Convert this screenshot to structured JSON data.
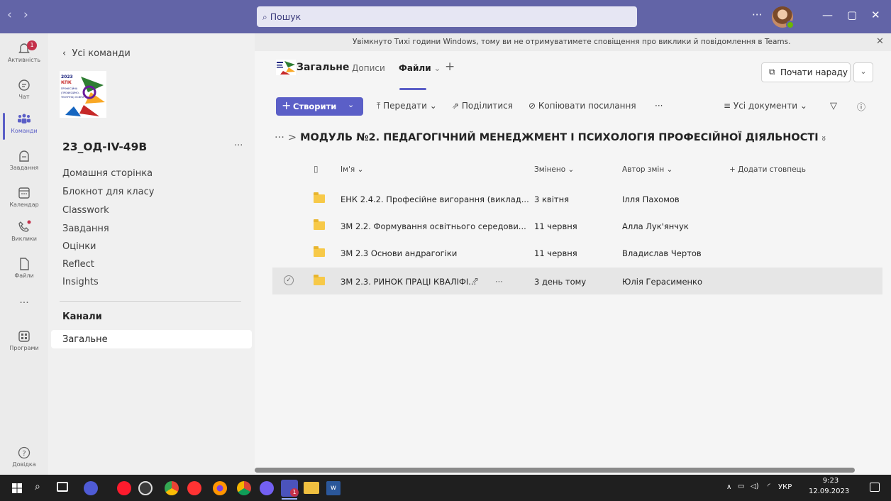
{
  "titlebar": {
    "back": "‹",
    "forward": "›",
    "search_placeholder": "Пошук",
    "more": "···",
    "minimize": "—",
    "maximize": "▢",
    "close": "✕"
  },
  "rail": {
    "items": [
      {
        "label": "Активність",
        "icon": "bell-icon",
        "badge": "1"
      },
      {
        "label": "Чат",
        "icon": "chat-icon"
      },
      {
        "label": "Команди",
        "icon": "teams-icon",
        "active": true
      },
      {
        "label": "Завдання",
        "icon": "assignments-icon"
      },
      {
        "label": "Календар",
        "icon": "calendar-icon"
      },
      {
        "label": "Виклики",
        "icon": "phone-icon"
      },
      {
        "label": "Файли",
        "icon": "file-icon"
      },
      {
        "label": "···",
        "icon": "more-icon"
      },
      {
        "label": "Програми",
        "icon": "apps-icon"
      }
    ],
    "help_label": "Довідка"
  },
  "teampane": {
    "back_label": "Усі команди",
    "logo_text": "2023 КПК ПРОФЕСІЙНА (ПРОФЕСІЙНО-ТЕХНІЧНА) ОСВІТА",
    "team_name": "23_ОД-IV-49В",
    "team_more": "···",
    "nav": [
      "Домашня сторінка",
      "Блокнот для класу",
      "Classwork",
      "Завдання",
      "Оцінки",
      "Reflect",
      "Insights"
    ],
    "channels_header": "Канали",
    "channels": [
      "Загальне"
    ]
  },
  "notice": {
    "text": "Увімкнуто Тихі години Windows, тому ви не отримуватимете сповіщення про виклики й повідомлення в Teams.",
    "close": "✕"
  },
  "channel": {
    "name": "Загальне",
    "tabs": [
      "Дописи",
      "Файли"
    ],
    "active_tab": "Файли",
    "add_tab": "+",
    "meet_label": "Почати нараду",
    "meet_more": "⌄"
  },
  "commandbar": {
    "create": "Створити",
    "upload": "Передати",
    "share": "Поділитися",
    "copy_link": "Копіювати посилання",
    "more": "···",
    "view": "Усі документи",
    "filter": "filter-icon",
    "info": "info-icon"
  },
  "breadcrumb": {
    "ellipsis": "···",
    "sep": ">",
    "title": "МОДУЛЬ №2. ПЕДАГОГІЧНИЙ МЕНЕДЖМЕНТ І ПСИХОЛОГІЯ ПРОФЕСІЙНОЇ ДІЯЛЬНОСТІ"
  },
  "files": {
    "columns": [
      "Ім'я",
      "Змінено",
      "Автор змін",
      "+ Додати стовпець"
    ],
    "rows": [
      {
        "name": "ЕНК 2.4.2. Професійне вигорання (виклад...",
        "modified": "3 квітня",
        "author": "Ілля Пахомов"
      },
      {
        "name": "ЗМ 2.2. Формування освітнього середови...",
        "modified": "11 червня",
        "author": "Алла Лук'янчук"
      },
      {
        "name": "ЗМ 2.3 Основи андрагогіки",
        "modified": "11 червня",
        "author": "Владислав Чертов"
      },
      {
        "name": "ЗМ 2.3. РИНОК ПРАЦІ КВАЛІФІ...",
        "modified": "3 день тому",
        "author": "Юлія Герасименко",
        "selected": true
      }
    ]
  },
  "taskbar": {
    "lang": "УКР",
    "time": "9:23",
    "date": "12.09.2023",
    "teams_badge": "1"
  },
  "colors": {
    "brand": "#6264a7",
    "accent": "#5b5fc7",
    "folder": "#f7c948"
  }
}
